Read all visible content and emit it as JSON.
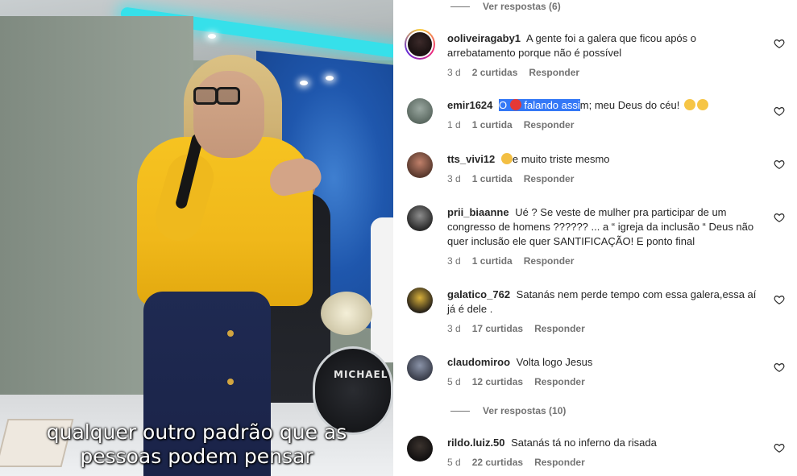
{
  "video": {
    "caption_lines": [
      "qualquer outro padrão que as",
      "pessoas podem pensar"
    ],
    "drum_label": "MICHAEL"
  },
  "comments": {
    "view_replies_top": "Ver respostas (6)",
    "view_replies_mid": "Ver respostas (10)",
    "reply_label": "Responder",
    "items": [
      {
        "user": "ooliveiragaby1",
        "text": "A gente foi a galera que ficou após o arrebatamento porque não é possível",
        "time": "3 d",
        "likes": "2 curtidas",
        "avatar_colors": [
          "#3b2a2a",
          "#1d1414"
        ]
      },
      {
        "user": "emir1624",
        "text_highlight_pre": "O",
        "text_highlight_post": "falando assi",
        "text_rest": "m; meu Deus do céu!",
        "time": "1 d",
        "likes": "1 curtida",
        "avatar_colors": [
          "#9aa7a0",
          "#5c6a62"
        ]
      },
      {
        "user": "tts_vivi12",
        "text": "e muito triste mesmo",
        "time": "3 d",
        "likes": "1 curtida",
        "avatar_colors": [
          "#c0806a",
          "#5a3a2e"
        ]
      },
      {
        "user": "prii_biaanne",
        "text": "Ué ? Se veste de mulher pra participar de um congresso de homens ?????? ... a “ igreja da inclusão “ Deus não quer inclusão ele quer SANTIFICAÇÃO! E ponto final",
        "time": "3 d",
        "likes": "1 curtida",
        "avatar_colors": [
          "#8d8d8d",
          "#2a2a2a"
        ]
      },
      {
        "user": "galatico_762",
        "text": "Satanás nem perde tempo com essa galera,essa aí já é dele .",
        "time": "3 d",
        "likes": "17 curtidas",
        "avatar_colors": [
          "#d8b03a",
          "#2a2419"
        ]
      },
      {
        "user": "claudomiroo",
        "text": "Volta logo Jesus",
        "time": "5 d",
        "likes": "12 curtidas",
        "avatar_colors": [
          "#8a93a8",
          "#3b3f4c"
        ]
      },
      {
        "user": "rildo.luiz.50",
        "text": "Satanás tá no inferno da risada",
        "time": "5 d",
        "likes": "22 curtidas",
        "avatar_colors": [
          "#3b332e",
          "#121010"
        ]
      }
    ]
  }
}
